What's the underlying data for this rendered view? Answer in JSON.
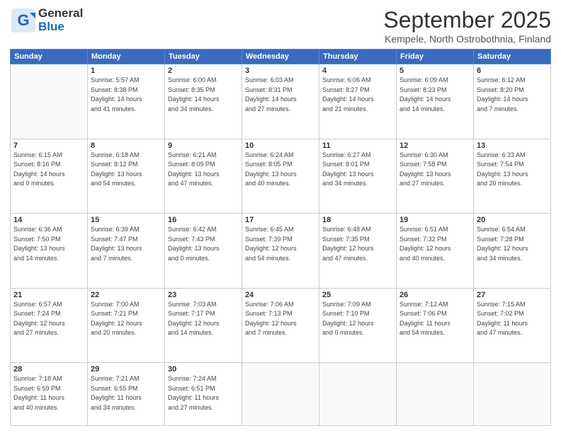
{
  "header": {
    "logo_general": "General",
    "logo_blue": "Blue",
    "title": "September 2025",
    "location": "Kempele, North Ostrobothnia, Finland"
  },
  "weekdays": [
    "Sunday",
    "Monday",
    "Tuesday",
    "Wednesday",
    "Thursday",
    "Friday",
    "Saturday"
  ],
  "weeks": [
    [
      {
        "day": "",
        "info": ""
      },
      {
        "day": "1",
        "info": "Sunrise: 5:57 AM\nSunset: 8:38 PM\nDaylight: 14 hours\nand 41 minutes."
      },
      {
        "day": "2",
        "info": "Sunrise: 6:00 AM\nSunset: 8:35 PM\nDaylight: 14 hours\nand 34 minutes."
      },
      {
        "day": "3",
        "info": "Sunrise: 6:03 AM\nSunset: 8:31 PM\nDaylight: 14 hours\nand 27 minutes."
      },
      {
        "day": "4",
        "info": "Sunrise: 6:06 AM\nSunset: 8:27 PM\nDaylight: 14 hours\nand 21 minutes."
      },
      {
        "day": "5",
        "info": "Sunrise: 6:09 AM\nSunset: 8:23 PM\nDaylight: 14 hours\nand 14 minutes."
      },
      {
        "day": "6",
        "info": "Sunrise: 6:12 AM\nSunset: 8:20 PM\nDaylight: 14 hours\nand 7 minutes."
      }
    ],
    [
      {
        "day": "7",
        "info": "Sunrise: 6:15 AM\nSunset: 8:16 PM\nDaylight: 14 hours\nand 0 minutes."
      },
      {
        "day": "8",
        "info": "Sunrise: 6:18 AM\nSunset: 8:12 PM\nDaylight: 13 hours\nand 54 minutes."
      },
      {
        "day": "9",
        "info": "Sunrise: 6:21 AM\nSunset: 8:09 PM\nDaylight: 13 hours\nand 47 minutes."
      },
      {
        "day": "10",
        "info": "Sunrise: 6:24 AM\nSunset: 8:05 PM\nDaylight: 13 hours\nand 40 minutes."
      },
      {
        "day": "11",
        "info": "Sunrise: 6:27 AM\nSunset: 8:01 PM\nDaylight: 13 hours\nand 34 minutes."
      },
      {
        "day": "12",
        "info": "Sunrise: 6:30 AM\nSunset: 7:58 PM\nDaylight: 13 hours\nand 27 minutes."
      },
      {
        "day": "13",
        "info": "Sunrise: 6:33 AM\nSunset: 7:54 PM\nDaylight: 13 hours\nand 20 minutes."
      }
    ],
    [
      {
        "day": "14",
        "info": "Sunrise: 6:36 AM\nSunset: 7:50 PM\nDaylight: 13 hours\nand 14 minutes."
      },
      {
        "day": "15",
        "info": "Sunrise: 6:39 AM\nSunset: 7:47 PM\nDaylight: 13 hours\nand 7 minutes."
      },
      {
        "day": "16",
        "info": "Sunrise: 6:42 AM\nSunset: 7:43 PM\nDaylight: 13 hours\nand 0 minutes."
      },
      {
        "day": "17",
        "info": "Sunrise: 6:45 AM\nSunset: 7:39 PM\nDaylight: 12 hours\nand 54 minutes."
      },
      {
        "day": "18",
        "info": "Sunrise: 6:48 AM\nSunset: 7:35 PM\nDaylight: 12 hours\nand 47 minutes."
      },
      {
        "day": "19",
        "info": "Sunrise: 6:51 AM\nSunset: 7:32 PM\nDaylight: 12 hours\nand 40 minutes."
      },
      {
        "day": "20",
        "info": "Sunrise: 6:54 AM\nSunset: 7:28 PM\nDaylight: 12 hours\nand 34 minutes."
      }
    ],
    [
      {
        "day": "21",
        "info": "Sunrise: 6:57 AM\nSunset: 7:24 PM\nDaylight: 12 hours\nand 27 minutes."
      },
      {
        "day": "22",
        "info": "Sunrise: 7:00 AM\nSunset: 7:21 PM\nDaylight: 12 hours\nand 20 minutes."
      },
      {
        "day": "23",
        "info": "Sunrise: 7:03 AM\nSunset: 7:17 PM\nDaylight: 12 hours\nand 14 minutes."
      },
      {
        "day": "24",
        "info": "Sunrise: 7:06 AM\nSunset: 7:13 PM\nDaylight: 12 hours\nand 7 minutes."
      },
      {
        "day": "25",
        "info": "Sunrise: 7:09 AM\nSunset: 7:10 PM\nDaylight: 12 hours\nand 0 minutes."
      },
      {
        "day": "26",
        "info": "Sunrise: 7:12 AM\nSunset: 7:06 PM\nDaylight: 11 hours\nand 54 minutes."
      },
      {
        "day": "27",
        "info": "Sunrise: 7:15 AM\nSunset: 7:02 PM\nDaylight: 11 hours\nand 47 minutes."
      }
    ],
    [
      {
        "day": "28",
        "info": "Sunrise: 7:18 AM\nSunset: 6:59 PM\nDaylight: 11 hours\nand 40 minutes."
      },
      {
        "day": "29",
        "info": "Sunrise: 7:21 AM\nSunset: 6:55 PM\nDaylight: 11 hours\nand 34 minutes."
      },
      {
        "day": "30",
        "info": "Sunrise: 7:24 AM\nSunset: 6:51 PM\nDaylight: 11 hours\nand 27 minutes."
      },
      {
        "day": "",
        "info": ""
      },
      {
        "day": "",
        "info": ""
      },
      {
        "day": "",
        "info": ""
      },
      {
        "day": "",
        "info": ""
      }
    ]
  ]
}
